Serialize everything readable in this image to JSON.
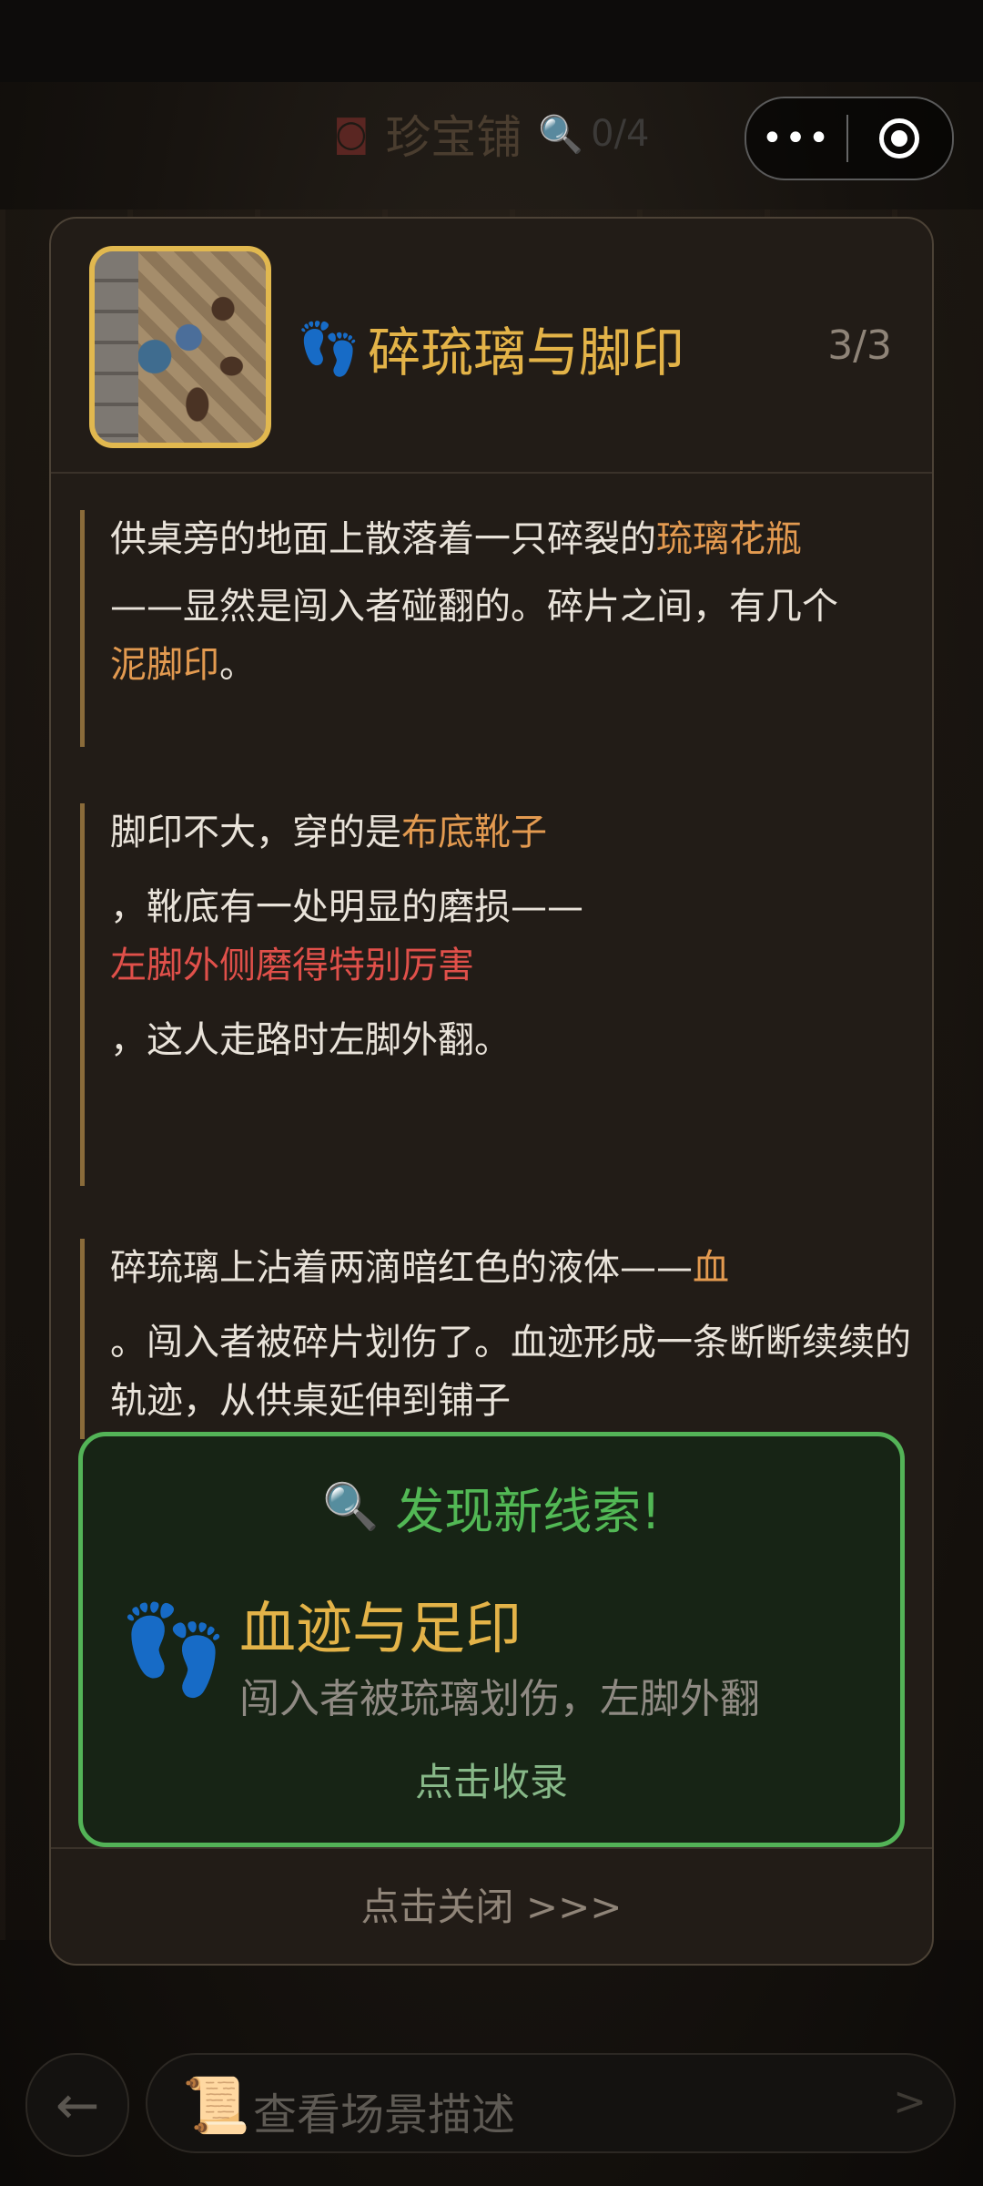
{
  "topbar": {
    "title": "珍宝铺",
    "clue_count": "0/4"
  },
  "modal": {
    "title": "碎琉璃与脚印",
    "progress": "3/3",
    "paragraphs": {
      "p1": {
        "t1": "供桌旁的地面上散落着一只碎裂的",
        "h1": "琉璃花瓶",
        "t2": "——显然是闯入者碰翻的。碎片之间，有几个",
        "h2": "泥脚印",
        "t3": "。"
      },
      "p2": {
        "t1": "脚印不大，穿的是",
        "h1": "布底靴子",
        "t2": "，靴底有一处明显的磨损——",
        "h2": "左脚外侧磨得特别厉害",
        "t3": "，这人走路时左脚外翻。"
      },
      "p3": {
        "t1": "碎琉璃上沾着两滴暗红色的液体——",
        "h1": "血",
        "t2": "。闯入者被碎片划伤了。血迹形成一条断断续续的轨迹，从供桌延伸到铺子"
      }
    },
    "close_hint": "点击关闭 >>>"
  },
  "new_clue": {
    "header": "发现新线索!",
    "title": "血迹与足印",
    "description": "闯入者被琉璃划伤，左脚外翻",
    "action": "点击收录"
  },
  "bottom_bar": {
    "back_glyph": "←",
    "scene_label": "查看场景描述",
    "chevron": ">"
  },
  "colors": {
    "accent_gold": "#e3b348",
    "highlight_orange": "#e39a50",
    "highlight_red": "#e0504a",
    "new_clue_green": "#53b357"
  },
  "icons": {
    "topbar": [
      "mask-icon",
      "magnifier-icon",
      "more-dots-icon",
      "target-icon"
    ],
    "clue": [
      "footprints-icon",
      "scroll-icon",
      "back-arrow-icon"
    ]
  }
}
